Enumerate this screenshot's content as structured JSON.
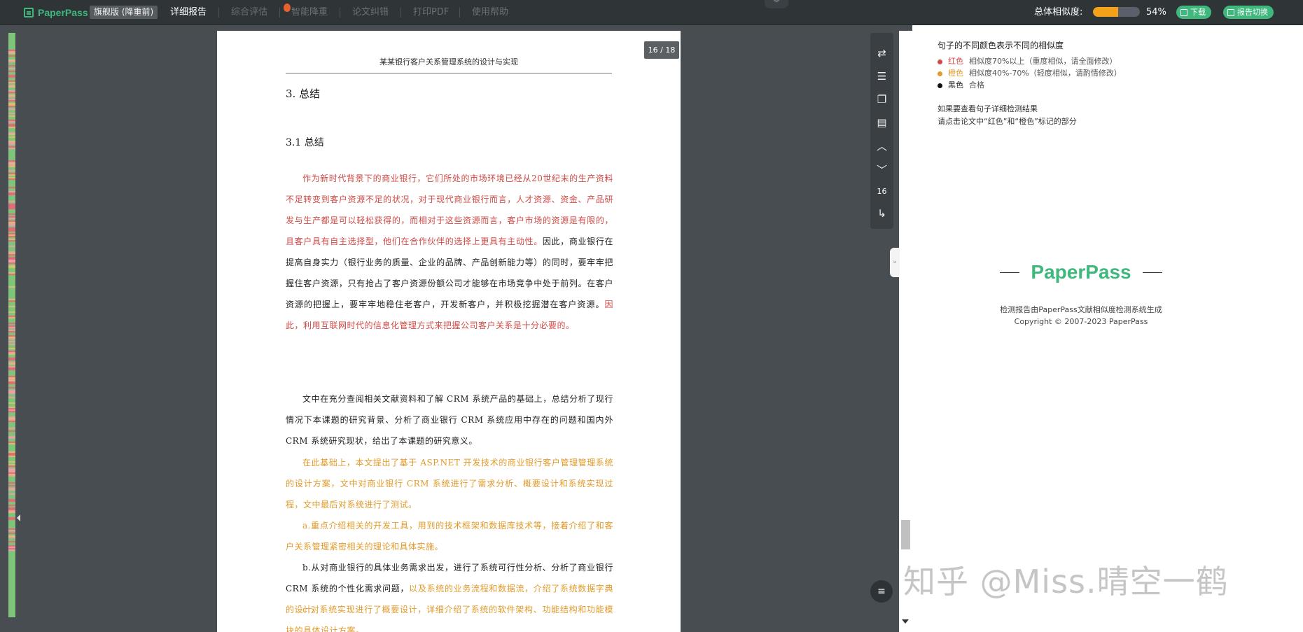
{
  "topbar": {
    "brand": "PaperPass",
    "edition": "旗舰版 (降重前)",
    "nav": [
      "详细报告",
      "综合评估",
      "智能降重",
      "论文纠错",
      "打印PDF",
      "使用帮助"
    ],
    "similarity_label": "总体相似度:",
    "similarity_value": "54%",
    "similarity_fraction": 0.54,
    "download_label": "下载",
    "switch_label": "报告切换",
    "accent_color": "#3fb87d",
    "bar_color": "#f5a21b"
  },
  "document": {
    "page_badge": "16 / 18",
    "running_title": "某某银行客户关系管理系统的设计与实现",
    "heading1": "3.  总结",
    "heading2": "3.1   总结",
    "p1": [
      {
        "t": "作为新时代背景下的商业银行，它们所处的市场环境已经从20世纪末的生产资料不足转变到客户资源不足的状况，对于现代商业银行而言，人才资源、资金、产品研发与生产都是可以轻松获得的，而相对于这些资源而言，客户市场的资源是有限的，且客户具有自主选择型，他们在合作伙伴的选择上更具有主动性。",
        "c": "red"
      },
      {
        "t": "因此，商业银行在提高自身实力（银行业务的质量、企业的品牌、产品创新能力等）的同时，要牢牢把握住客户资源，只有抢占了客户资源份额公司才能够在市场竞争中处于前列。在客户资源的把握上，要牢牢地稳住老客户，开发新客户，并积极挖掘潜在客户资源。",
        "c": "blk"
      },
      {
        "t": "因此，利用互联网时代的信息化管理方式来把握公司客户关系是十分必要的。",
        "c": "red"
      }
    ],
    "p2": "文中在充分查阅相关文献资料和了解 CRM 系统产品的基础上，总结分析了现行情况下本课题的研究背景、分析了商业银行 CRM 系统应用中存在的问题和国内外 CRM 系统研究现状，给出了本课题的研究意义。",
    "p3": "在此基础上，本文提出了基于 ASP.NET 开发技术的商业银行客户管理管理系统的设计方案，文中对商业银行 CRM 系统进行了需求分析、概要设计和系统实现过程，文中最后对系统进行了测试。",
    "p4": "a.重点介绍相关的开发工具，用到的技术框架和数据库技术等，接着介绍了和客户关系管理紧密相关的理论和具体实施。",
    "p5_black": "b.从对商业银行的具体业务需求出发，进行了系统可行性分析、分析了商业银行 CRM 系统的个性化需求问题，",
    "p5_orange": "以及系统的业务流程和数据流，介绍了系统数据字典的设计。",
    "p6": "c.对系统实现进行了概要设计，详细介绍了系统的软件架构、功能结构和功能模块的具体设计方案。"
  },
  "toolbar": {
    "page_number": "16",
    "icons": [
      "swap-icon",
      "outline-icon",
      "copy-icon",
      "align-icon",
      "chevron-up-icon",
      "chevron-down-icon",
      "jump-icon"
    ]
  },
  "legend": {
    "title": "句子的不同颜色表示不同的相似度",
    "items": [
      {
        "color_name": "红色",
        "desc": "相似度70%以上（重度相似，请全面修改）",
        "color": "#d14a45"
      },
      {
        "color_name": "橙色",
        "desc": "相似度40%-70%（轻度相似，请酌情修改）",
        "color": "#e19a2a"
      },
      {
        "color_name": "黑色",
        "desc": "合格",
        "color": "#222222"
      }
    ],
    "hint1": "如果要查看句子详细检测结果",
    "hint2": "请点击论文中“红色”和“橙色”标记的部分"
  },
  "footer": {
    "logo_text": "PaperPass",
    "line1": "检测报告由PaperPass文献相似度检测系统生成",
    "line2": "Copyright © 2007-2023 PaperPass"
  },
  "watermark": "知乎 @Miss.晴空一鹤"
}
